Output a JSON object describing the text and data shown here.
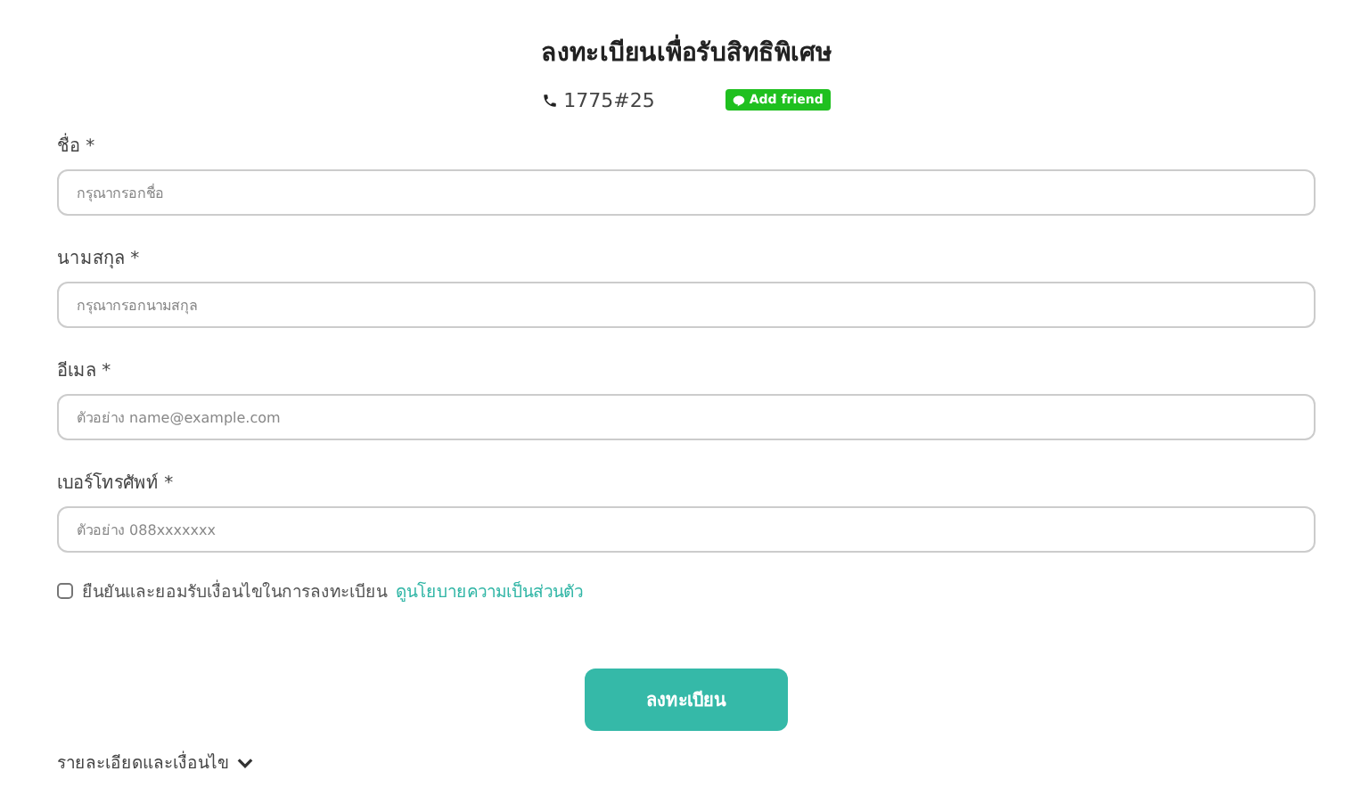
{
  "title": "ลงทะเบียนเพื่อรับสิทธิพิเศษ",
  "contact": {
    "phone": "1775#25",
    "line_button": "Add friend"
  },
  "fields": [
    {
      "label": "ชื่อ *",
      "placeholder": "กรุณากรอกชื่อ"
    },
    {
      "label": "นามสกุล *",
      "placeholder": "กรุณากรอกนามสกุล"
    },
    {
      "label": "อีเมล *",
      "placeholder": "ตัวอย่าง name@example.com"
    },
    {
      "label": "เบอร์โทรศัพท์ *",
      "placeholder": "ตัวอย่าง 088xxxxxxx"
    }
  ],
  "consent": {
    "checked": false,
    "text": "ยืนยันและยอมรับเงื่อนไขในการลงทะเบียน",
    "link": "ดูนโยบายความเป็นส่วนตัว"
  },
  "submit": "ลงทะเบียน",
  "details": {
    "label": "รายละเอียดและเงื่อนไข"
  }
}
